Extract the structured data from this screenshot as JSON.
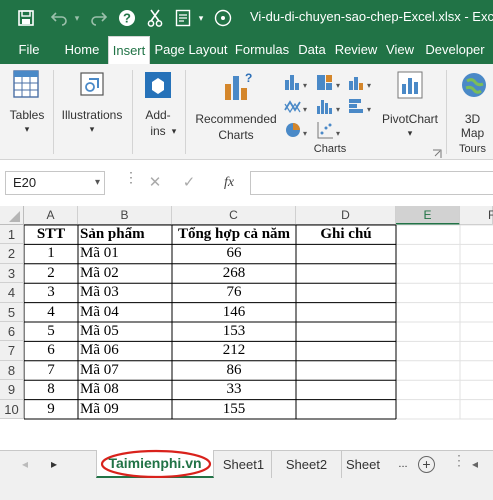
{
  "window": {
    "title": "Vi-du-di-chuyen-sao-chep-Excel.xlsx  -  Excel"
  },
  "ribbon_tabs": [
    {
      "label": "File"
    },
    {
      "label": "Home"
    },
    {
      "label": "Insert"
    },
    {
      "label": "Page Layout"
    },
    {
      "label": "Formulas"
    },
    {
      "label": "Data"
    },
    {
      "label": "Review"
    },
    {
      "label": "View"
    },
    {
      "label": "Developer"
    }
  ],
  "active_tab": "Insert",
  "ribbon": {
    "tables": "Tables",
    "illustrations": "Illustrations",
    "addins_line1": "Add-",
    "addins_line2": "ins",
    "recommended_line1": "Recommended",
    "recommended_line2": "Charts",
    "pivotchart": "PivotChart",
    "map_line1": "3D",
    "map_line2": "Map",
    "charts_group": "Charts",
    "tours_group": "Tours"
  },
  "formula_bar": {
    "name_box": "E20",
    "fx": "fx",
    "cancel": "✕",
    "enter": "✓",
    "formula": ""
  },
  "columns": [
    "A",
    "B",
    "C",
    "D",
    "E",
    "F"
  ],
  "selected_column": "E",
  "rows": [
    "1",
    "2",
    "3",
    "4",
    "5",
    "6",
    "7",
    "8",
    "9",
    "10"
  ],
  "table": {
    "headers": [
      "STT",
      "Sản phẩm",
      "Tổng hợp cả năm",
      "Ghi chú"
    ],
    "data": [
      [
        "1",
        "Mã 01",
        "66",
        ""
      ],
      [
        "2",
        "Mã 02",
        "268",
        ""
      ],
      [
        "3",
        "Mã 03",
        "76",
        ""
      ],
      [
        "4",
        "Mã 04",
        "146",
        ""
      ],
      [
        "5",
        "Mã 05",
        "153",
        ""
      ],
      [
        "6",
        "Mã 06",
        "212",
        ""
      ],
      [
        "7",
        "Mã 07",
        "86",
        ""
      ],
      [
        "8",
        "Mã 08",
        "33",
        ""
      ],
      [
        "9",
        "Mã 09",
        "155",
        ""
      ]
    ]
  },
  "sheets": [
    {
      "label": "Taimienphi.vn"
    },
    {
      "label": "Sheet1"
    },
    {
      "label": "Sheet2"
    },
    {
      "label": "Sheet"
    }
  ],
  "sheet_nav": {
    "next": "▸",
    "more": "...",
    "add": "+"
  },
  "colors": {
    "excel_green": "#217346",
    "highlight_circle": "#d9221c"
  }
}
